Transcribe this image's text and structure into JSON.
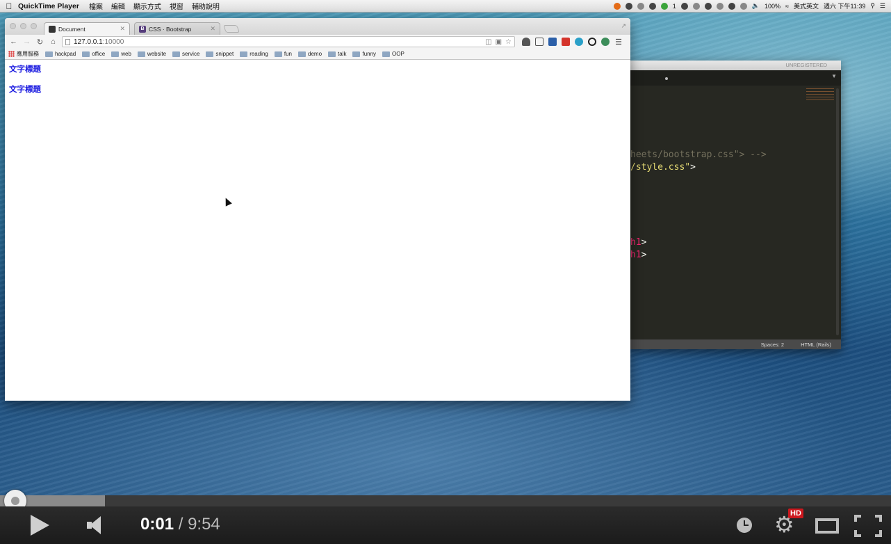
{
  "menubar": {
    "app_name": "QuickTime Player",
    "menus": [
      "檔案",
      "編輯",
      "顯示方式",
      "視窗",
      "輔助說明"
    ],
    "battery": "100%",
    "input_method": "美式英文",
    "clock": "週六 下午11:39",
    "status_misc": "1"
  },
  "browser": {
    "tabs": [
      {
        "title": "Document"
      },
      {
        "title": "CSS · Bootstrap"
      }
    ],
    "url": {
      "host": "127.0.0.1",
      "port": ":10000"
    },
    "bookmarks": {
      "apps_label": "應用服務",
      "folders": [
        "hackpad",
        "office",
        "web",
        "website",
        "service",
        "snippet",
        "reading",
        "fun",
        "demo",
        "talk",
        "funny",
        "OOP"
      ]
    },
    "page": {
      "headings": [
        "文字標題",
        "文字標題"
      ]
    }
  },
  "editor": {
    "title": "UNREGISTERED",
    "code_lines": {
      "line1": "heets/bootstrap.css\"> -->",
      "line2_text": "/style.css\"",
      "line2_end": ">",
      "line3_tag": "h1",
      "line4_tag": "h1",
      "tag_close": ">"
    },
    "status": {
      "spaces": "Spaces: 2",
      "syntax": "HTML (Rails)"
    }
  },
  "player": {
    "current_time": "0:01",
    "separator": "/",
    "duration": "9:54",
    "progress_fraction": 0.0017,
    "buffered_fraction": 0.118,
    "hd_label": "HD"
  }
}
